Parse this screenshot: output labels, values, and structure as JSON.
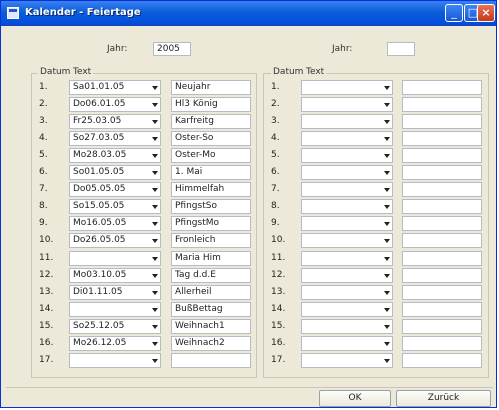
{
  "window": {
    "title": "Kalender - Feiertage"
  },
  "left": {
    "jahr_label": "Jahr:",
    "jahr_value": "2005",
    "col_datum": "Datum",
    "col_text": "Text",
    "rows": [
      {
        "num": "1.",
        "date": "Sa01.01.05",
        "text": "Neujahr"
      },
      {
        "num": "2.",
        "date": "Do06.01.05",
        "text": "Hl3 König"
      },
      {
        "num": "3.",
        "date": "Fr25.03.05",
        "text": "Karfreitg"
      },
      {
        "num": "4.",
        "date": "So27.03.05",
        "text": "Oster-So"
      },
      {
        "num": "5.",
        "date": "Mo28.03.05",
        "text": "Oster-Mo"
      },
      {
        "num": "6.",
        "date": "So01.05.05",
        "text": "1. Mai"
      },
      {
        "num": "7.",
        "date": "Do05.05.05",
        "text": "Himmelfah"
      },
      {
        "num": "8.",
        "date": "So15.05.05",
        "text": "PfingstSo"
      },
      {
        "num": "9.",
        "date": "Mo16.05.05",
        "text": "PfingstMo"
      },
      {
        "num": "10.",
        "date": "Do26.05.05",
        "text": "Fronleich"
      },
      {
        "num": "11.",
        "date": "",
        "text": "Maria Him"
      },
      {
        "num": "12.",
        "date": "Mo03.10.05",
        "text": "Tag d.d.E"
      },
      {
        "num": "13.",
        "date": "Di01.11.05",
        "text": "Allerheil"
      },
      {
        "num": "14.",
        "date": "",
        "text": "BußBettag"
      },
      {
        "num": "15.",
        "date": "So25.12.05",
        "text": "Weihnach1"
      },
      {
        "num": "16.",
        "date": "Mo26.12.05",
        "text": "Weihnach2"
      },
      {
        "num": "17.",
        "date": "",
        "text": ""
      }
    ]
  },
  "right": {
    "jahr_label": "Jahr:",
    "jahr_value": "",
    "col_datum": "Datum",
    "col_text": "Text",
    "rows": [
      {
        "num": "1.",
        "date": "",
        "text": ""
      },
      {
        "num": "2.",
        "date": "",
        "text": ""
      },
      {
        "num": "3.",
        "date": "",
        "text": ""
      },
      {
        "num": "4.",
        "date": "",
        "text": ""
      },
      {
        "num": "5.",
        "date": "",
        "text": ""
      },
      {
        "num": "6.",
        "date": "",
        "text": ""
      },
      {
        "num": "7.",
        "date": "",
        "text": ""
      },
      {
        "num": "8.",
        "date": "",
        "text": ""
      },
      {
        "num": "9.",
        "date": "",
        "text": ""
      },
      {
        "num": "10.",
        "date": "",
        "text": ""
      },
      {
        "num": "11.",
        "date": "",
        "text": ""
      },
      {
        "num": "12.",
        "date": "",
        "text": ""
      },
      {
        "num": "13.",
        "date": "",
        "text": ""
      },
      {
        "num": "14.",
        "date": "",
        "text": ""
      },
      {
        "num": "15.",
        "date": "",
        "text": ""
      },
      {
        "num": "16.",
        "date": "",
        "text": ""
      },
      {
        "num": "17.",
        "date": "",
        "text": ""
      }
    ]
  },
  "buttons": {
    "ok": "OK",
    "back": "Zurück"
  },
  "colors": {
    "titlebar": "#0a5ed8",
    "window_bg": "#ece9d8"
  }
}
